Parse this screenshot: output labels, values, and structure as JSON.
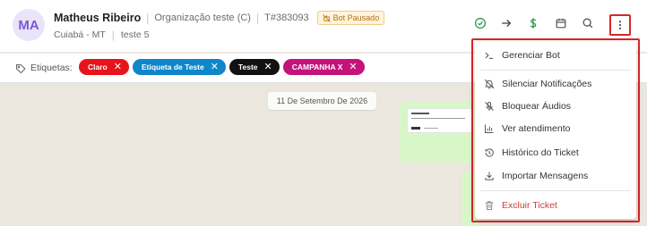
{
  "header": {
    "avatar_initials": "MA",
    "contact_name": "Matheus Ribeiro",
    "separator": "|",
    "organization": "Organização teste (C)",
    "ticket_number": "T#383093",
    "bot_badge": "Bot Pausado",
    "location": "Cuiabá - MT",
    "queue": "teste 5"
  },
  "header_icons": [
    "check-circle-icon",
    "arrow-right-icon",
    "dollar-icon",
    "calendar-icon",
    "search-icon",
    "kebab-menu-icon"
  ],
  "tags": {
    "label": "Etiquetas:",
    "items": [
      {
        "label": "Claro",
        "color": "#e8141c"
      },
      {
        "label": "Etiqueta de Teste",
        "color": "#0e86c9"
      },
      {
        "label": "Teste",
        "color": "#111111"
      },
      {
        "label": "CAMPANHA X",
        "color": "#c2147b"
      }
    ],
    "remove_glyph": "✕"
  },
  "chat": {
    "date": "11 De Setembro De 2026"
  },
  "menu": {
    "items": [
      {
        "label": "Gerenciar Bot",
        "icon": "terminal-icon"
      },
      {
        "label": "Silenciar Notificações",
        "icon": "bell-off-icon"
      },
      {
        "label": "Bloquear Áudios",
        "icon": "mic-off-icon"
      },
      {
        "label": "Ver atendimento",
        "icon": "bar-chart-icon"
      },
      {
        "label": "Histórico do Ticket",
        "icon": "history-icon"
      },
      {
        "label": "Importar Mensagens",
        "icon": "download-icon"
      },
      {
        "label": "Excluir Ticket",
        "icon": "trash-icon"
      }
    ]
  },
  "colors": {
    "accent_green": "#2e9a4d",
    "highlight_red": "#d9262b",
    "danger_text": "#d13b3b",
    "avatar_text": "#7c59d6"
  }
}
